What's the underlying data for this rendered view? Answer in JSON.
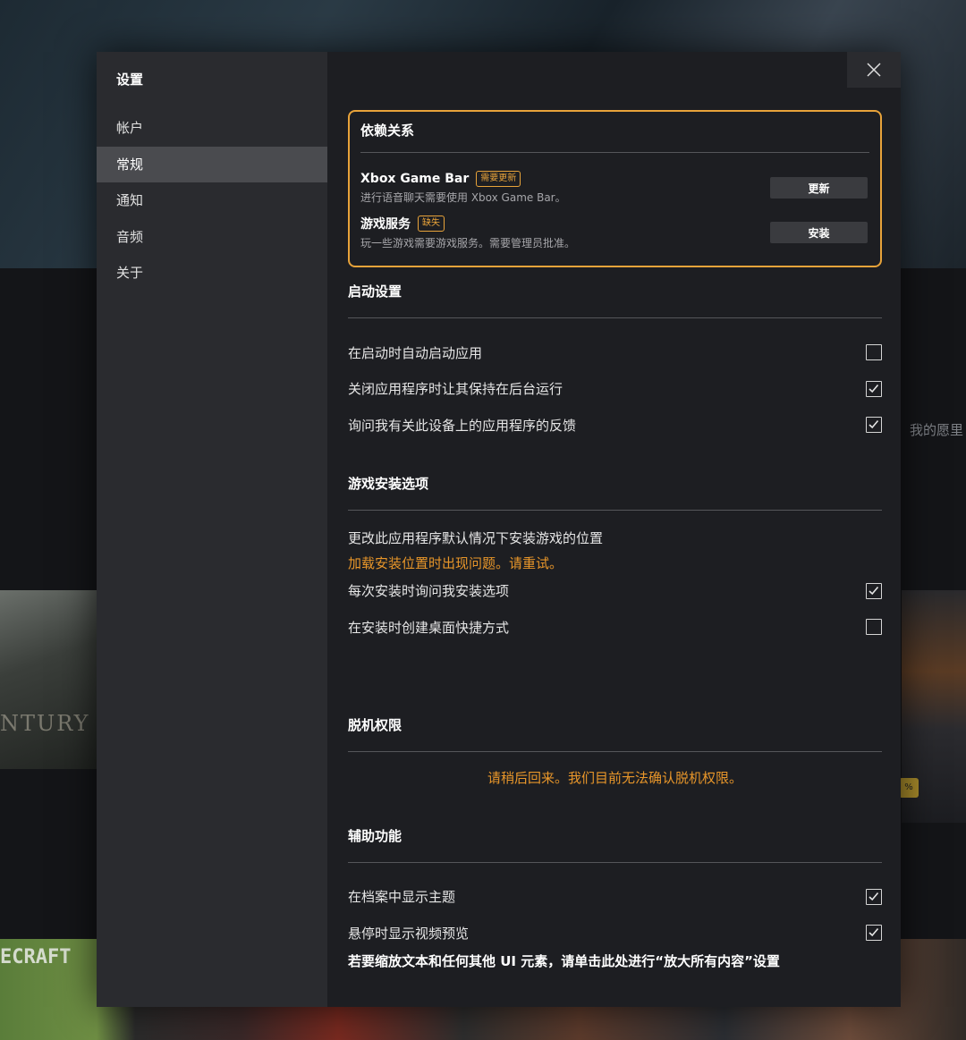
{
  "background": {
    "left_art_text": "NTURY",
    "bottom_art_text": "ECRAFT",
    "wishlist_text": "我的愿里",
    "badge_text": "%"
  },
  "sidebar": {
    "title": "设置",
    "items": [
      {
        "label": "帐户"
      },
      {
        "label": "常规"
      },
      {
        "label": "通知"
      },
      {
        "label": "音频"
      },
      {
        "label": "关于"
      }
    ],
    "active_index": 1
  },
  "dependencies": {
    "title": "依赖关系",
    "items": [
      {
        "name": "Xbox Game Bar",
        "tag": "需要更新",
        "desc": "进行语音聊天需要使用 Xbox Game Bar。",
        "button": "更新"
      },
      {
        "name": "游戏服务",
        "tag": "缺失",
        "desc": "玩一些游戏需要游戏服务。需要管理员批准。",
        "button": "安装"
      }
    ]
  },
  "startup": {
    "title": "启动设置",
    "options": [
      {
        "label": "在启动时自动启动应用",
        "checked": false
      },
      {
        "label": "关闭应用程序时让其保持在后台运行",
        "checked": true
      },
      {
        "label": "询问我有关此设备上的应用程序的反馈",
        "checked": true
      }
    ]
  },
  "install": {
    "title": "游戏安装选项",
    "change_location": "更改此应用程序默认情况下安装游戏的位置",
    "error": "加载安装位置时出现问题。请重试。",
    "options": [
      {
        "label": "每次安装时询问我安装选项",
        "checked": true
      },
      {
        "label": "在安装时创建桌面快捷方式",
        "checked": false
      }
    ]
  },
  "offline": {
    "title": "脱机权限",
    "message": "请稍后回来。我们目前无法确认脱机权限。"
  },
  "accessibility": {
    "title": "辅助功能",
    "options": [
      {
        "label": "在档案中显示主题",
        "checked": true
      },
      {
        "label": "悬停时显示视频预览",
        "checked": true
      }
    ],
    "zoom_link": "若要缩放文本和任何其他 UI 元素，请单击此处进行“放大所有内容”设置"
  },
  "colors": {
    "accent": "#e8a33a",
    "warning": "#e8962a",
    "panel": "#1d1e22",
    "sidebar": "#2a2b2f"
  }
}
